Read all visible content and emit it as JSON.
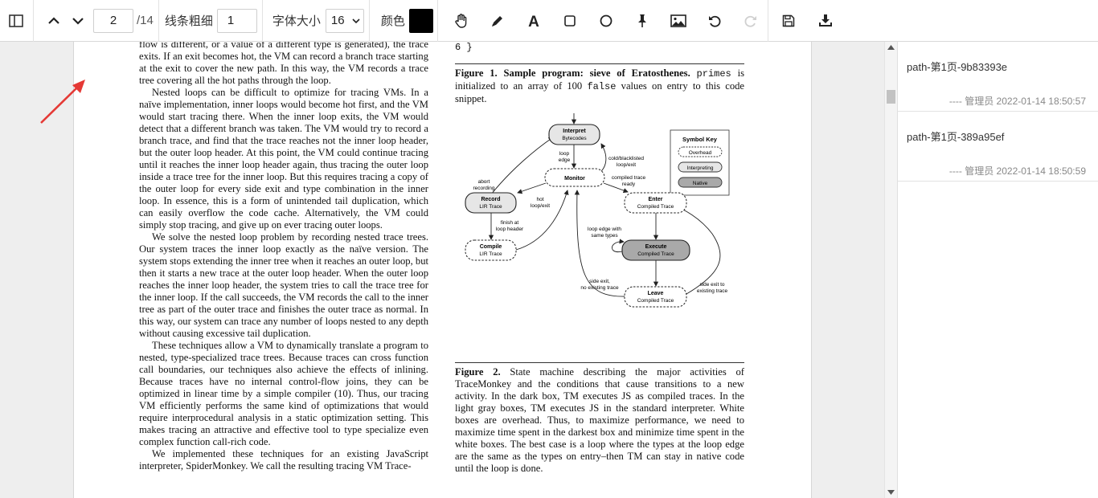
{
  "toolbar": {
    "page_current": "2",
    "page_total": "/14",
    "line_width_label": "线条粗细",
    "line_width_value": "1",
    "font_size_label": "字体大小",
    "font_size_value": "16",
    "color_label": "颜色",
    "color_value": "#000000"
  },
  "document": {
    "left_column": [
      "flow is different, or a value of a different type is generated), the trace exits. If an exit becomes hot, the VM can record a branch trace starting at the exit to cover the new path. In this way, the VM records a trace tree covering all the hot paths through the loop.",
      "Nested loops can be difficult to optimize for tracing VMs. In a naïve implementation, inner loops would become hot first, and the VM would start tracing there. When the inner loop exits, the VM would detect that a different branch was taken. The VM would try to record a branch trace, and find that the trace reaches not the inner loop header, but the outer loop header. At this point, the VM could continue tracing until it reaches the inner loop header again, thus tracing the outer loop inside a trace tree for the inner loop. But this requires tracing a copy of the outer loop for every side exit and type combination in the inner loop. In essence, this is a form of unintended tail duplication, which can easily overflow the code cache. Alternatively, the VM could simply stop tracing, and give up on ever tracing outer loops.",
      "We solve the nested loop problem by recording nested trace trees. Our system traces the inner loop exactly as the naïve version. The system stops extending the inner tree when it reaches an outer loop, but then it starts a new trace at the outer loop header. When the outer loop reaches the inner loop header, the system tries to call the trace tree for the inner loop. If the call succeeds, the VM records the call to the inner tree as part of the outer trace and finishes the outer trace as normal. In this way, our system can trace any number of loops nested to any depth without causing excessive tail duplication.",
      "These techniques allow a VM to dynamically translate a program to nested, type-specialized trace trees. Because traces can cross function call boundaries, our techniques also achieve the effects of inlining. Because traces have no internal control-flow joins, they can be optimized in linear time by a simple compiler (10). Thus, our tracing VM efficiently performs the same kind of optimizations that would require interprocedural analysis in a static optimization setting. This makes tracing an attractive and effective tool to type specialize even complex function call-rich code.",
      "We implemented these techniques for an existing JavaScript interpreter, SpiderMonkey. We call the resulting tracing VM Trace-"
    ],
    "code_tail": "6 }",
    "fig1_label": "Figure 1.",
    "fig1_title": "Sample program: sieve of Eratosthenes.",
    "fig1_code": "primes",
    "fig1_text1": "is initialized to an array of 100",
    "fig1_code2": "false",
    "fig1_text2": "values on entry to this code snippet.",
    "fig2_label": "Figure 2.",
    "fig2_text": "State machine describing the major activities of TraceMonkey and the conditions that cause transitions to a new activity. In the dark box, TM executes JS as compiled traces. In the light gray boxes, TM executes JS in the standard interpreter. White boxes are overhead. Thus, to maximize performance, we need to maximize time spent in the darkest box and minimize time spent in the white boxes. The best case is a loop where the types at the loop edge are the same as the types on entry–then TM can stay in native code until the loop is done."
  },
  "diagram": {
    "symbol_key": "Symbol Key",
    "key_overhead": "Overhead",
    "key_interpreting": "Interpreting",
    "key_native": "Native",
    "interpret_1": "Interpret",
    "interpret_2": "Bytecodes",
    "monitor": "Monitor",
    "record_1": "Record",
    "record_2": "LIR Trace",
    "compile_1": "Compile",
    "compile_2": "LIR Trace",
    "enter_1": "Enter",
    "enter_2": "Compiled Trace",
    "execute_1": "Execute",
    "execute_2": "Compiled Trace",
    "leave_1": "Leave",
    "leave_2": "Compiled Trace",
    "lbl_loop_edge_1": "loop",
    "lbl_loop_edge_2": "edge",
    "lbl_cold_1": "cold/blacklisted",
    "lbl_cold_2": "loop/exit",
    "lbl_abort_1": "abort",
    "lbl_abort_2": "recording",
    "lbl_hot_1": "hot",
    "lbl_hot_2": "loop/exit",
    "lbl_compiled_ready_1": "compiled trace",
    "lbl_compiled_ready_2": "ready",
    "lbl_finish_1": "finish at",
    "lbl_finish_2": "loop header",
    "lbl_same_types_1": "loop edge with",
    "lbl_same_types_2": "same types",
    "lbl_side_exit_1": "side exit,",
    "lbl_side_exit_2": "no existing trace",
    "lbl_side_exit_existing_1": "side exit to",
    "lbl_side_exit_existing_2": "existing trace"
  },
  "sidebar": {
    "notes": [
      {
        "title": "path-第1页-9b83393e",
        "meta": "---- 管理员 2022-01-14 18:50:57"
      },
      {
        "title": "path-第1页-389a95ef",
        "meta": "---- 管理员 2022-01-14 18:50:59"
      }
    ]
  },
  "colors": {
    "annotation_arrow": "#e53935",
    "native_box": "#a9a9a9",
    "interpreting_box": "#e6e6e6",
    "overhead_box": "#ffffff"
  },
  "icons": [
    "sidebar-toggle-icon",
    "chevron-up-icon",
    "chevron-down-icon",
    "hand-icon",
    "pencil-icon",
    "text-icon",
    "rectangle-icon",
    "circle-icon",
    "pin-icon",
    "image-icon",
    "undo-icon",
    "redo-icon",
    "save-icon",
    "download-icon"
  ]
}
